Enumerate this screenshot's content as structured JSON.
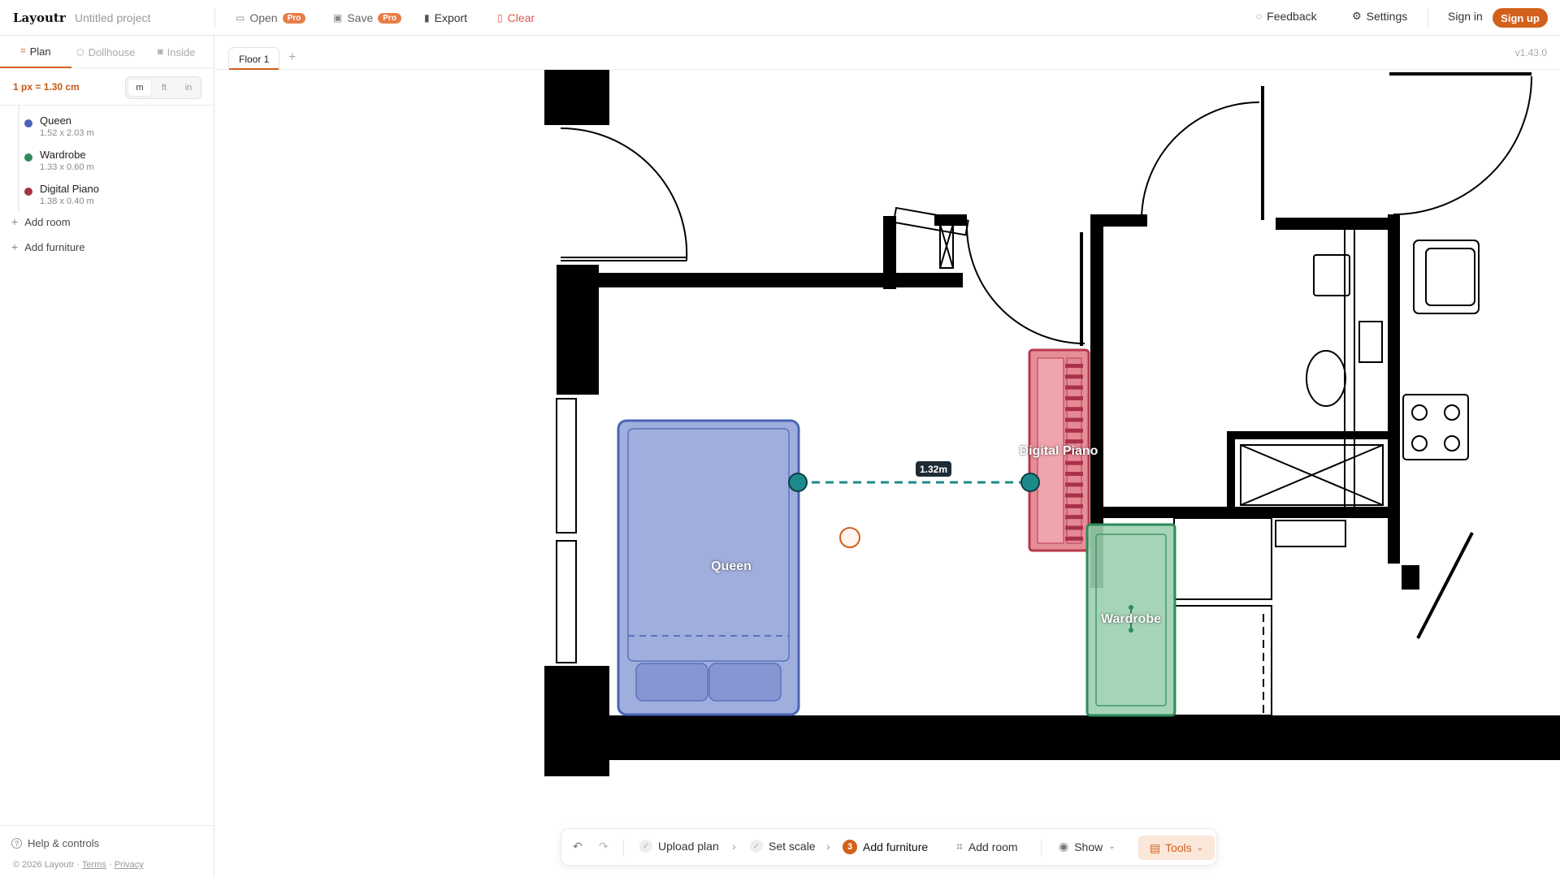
{
  "header": {
    "logo": "Layoutr",
    "project_name": "Untitled project",
    "open_label": "Open",
    "open_badge": "Pro",
    "save_label": "Save",
    "save_badge": "Pro",
    "export_label": "Export",
    "clear_label": "Clear",
    "feedback_label": "Feedback",
    "settings_label": "Settings",
    "signin_label": "Sign in",
    "signup_label": "Sign up"
  },
  "view_tabs": [
    {
      "label": "Plan",
      "active": true
    },
    {
      "label": "Dollhouse",
      "active": false
    },
    {
      "label": "Inside",
      "active": false
    }
  ],
  "scale": {
    "text": "1 px = 1.30 cm",
    "units": [
      "m",
      "ft",
      "in"
    ],
    "selected_unit": "m"
  },
  "furniture": [
    {
      "name": "Queen",
      "dims": "1.52 x 2.03 m",
      "color": "#4a64b5"
    },
    {
      "name": "Wardrobe",
      "dims": "1.33 x 0.60 m",
      "color": "#2f8a5a"
    },
    {
      "name": "Digital Piano",
      "dims": "1.38 x 0.40 m",
      "color": "#a8324a"
    }
  ],
  "sidebar_actions": {
    "add_room": "Add room",
    "add_furniture": "Add furniture"
  },
  "footer": {
    "help": "Help & controls",
    "copyright": "© 2026 Layoutr ·",
    "terms": "Terms",
    "dot": "·",
    "privacy": "Privacy"
  },
  "floors": {
    "tabs": [
      "Floor 1"
    ],
    "add": "+"
  },
  "version": "v1.43.0",
  "canvas": {
    "labels": {
      "queen": "Queen",
      "wardrobe": "Wardrobe",
      "piano": "Digital Piano"
    },
    "measurement": "1.32m"
  },
  "toolbar": {
    "upload_plan": "Upload plan",
    "set_scale": "Set scale",
    "step_number": "3",
    "add_furniture": "Add furniture",
    "add_room": "Add room",
    "show": "Show",
    "tools": "Tools"
  },
  "colors": {
    "accent": "#d2601a",
    "queen_fill": "#8fa0d8",
    "wardrobe_fill": "#9ccfae",
    "piano_fill": "#e07a86"
  }
}
